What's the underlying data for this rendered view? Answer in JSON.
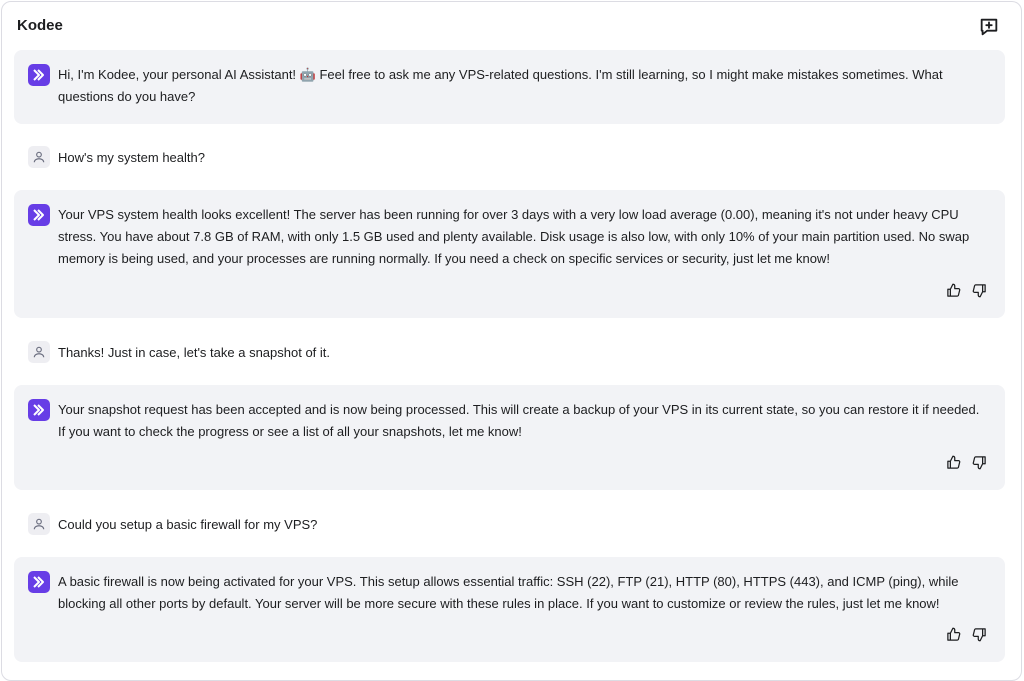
{
  "header": {
    "title": "Kodee",
    "new_chat_icon": "chat-plus-icon"
  },
  "colors": {
    "accent": "#673de6",
    "ai_bubble": "#f2f3f6",
    "text": "#1d1e20"
  },
  "messages": [
    {
      "role": "assistant",
      "text": "Hi, I'm Kodee, your personal AI Assistant! 🤖 Feel free to ask me any VPS-related questions. I'm still learning, so I might make mistakes sometimes. What questions do you have?"
    },
    {
      "role": "user",
      "text": "How's my system health?"
    },
    {
      "role": "assistant",
      "text": "Your VPS system health looks excellent! The server has been running for over 3 days with a very low load average (0.00), meaning it's not under heavy CPU stress. You have about 7.8 GB of RAM, with only 1.5 GB used and plenty available. Disk usage is also low, with only 10% of your main partition used. No swap memory is being used, and your processes are running normally. If you need a check on specific services or security, just let me know!"
    },
    {
      "role": "user",
      "text": "Thanks! Just in case, let's take a snapshot of it."
    },
    {
      "role": "assistant",
      "text": "Your snapshot request has been accepted and is now being processed. This will create a backup of your VPS in its current state, so you can restore it if needed. If you want to check the progress or see a list of all your snapshots, let me know!"
    },
    {
      "role": "user",
      "text": "Could you setup a basic firewall for my VPS?"
    },
    {
      "role": "assistant",
      "text": "A basic firewall is now being activated for your VPS. This setup allows essential traffic: SSH (22), FTP (21), HTTP (80), HTTPS (443), and ICMP (ping), while blocking all other ports by default. Your server will be more secure with these rules in place. If you want to customize or review the rules, just let me know!"
    }
  ]
}
